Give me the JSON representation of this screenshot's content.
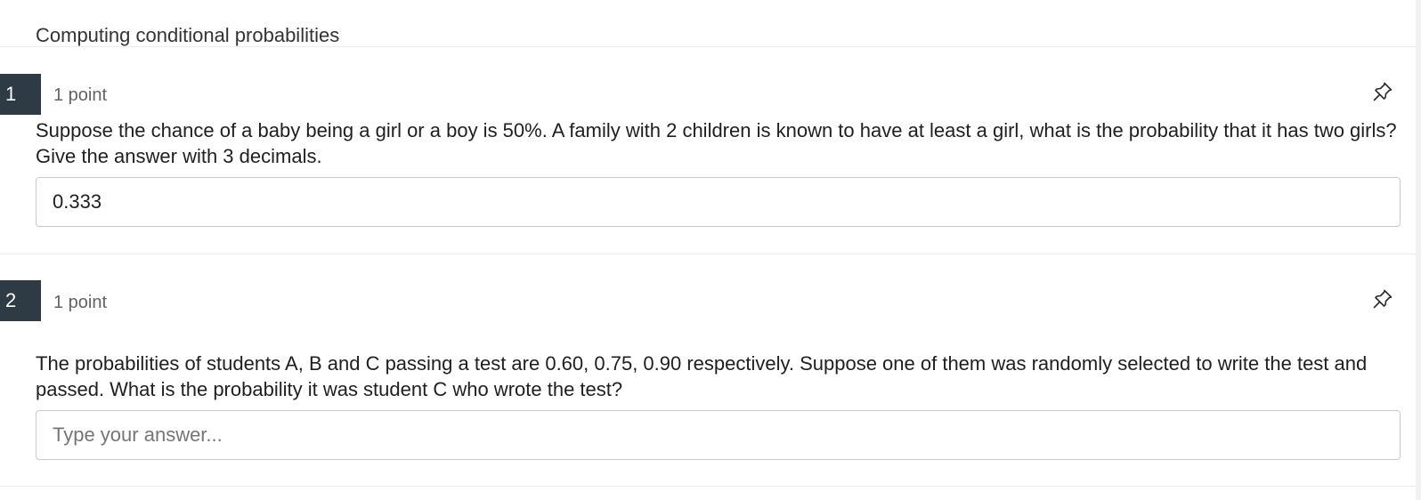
{
  "section": {
    "title": "Computing conditional probabilities"
  },
  "questions": [
    {
      "number": "1",
      "points": "1 point",
      "text": "Suppose the chance of a baby being a girl or a boy is 50%. A family with 2 children is known to have at least a girl, what is the probability that it has two girls? Give the answer with 3 decimals.",
      "answer_value": "0.333",
      "answer_placeholder": ""
    },
    {
      "number": "2",
      "points": "1 point",
      "text": "The probabilities of students A, B and C passing a test are 0.60, 0.75, 0.90 respectively. Suppose one of them was randomly selected to write the test and passed. What is the probability it was student C who wrote the test?",
      "answer_value": "",
      "answer_placeholder": "Type your answer..."
    }
  ],
  "icons": {
    "pin": "pin-icon"
  },
  "colors": {
    "number_badge_bg": "#2e3a44",
    "number_badge_text": "#ffffff",
    "points_text": "#636363",
    "input_border": "#c9c9c9"
  }
}
